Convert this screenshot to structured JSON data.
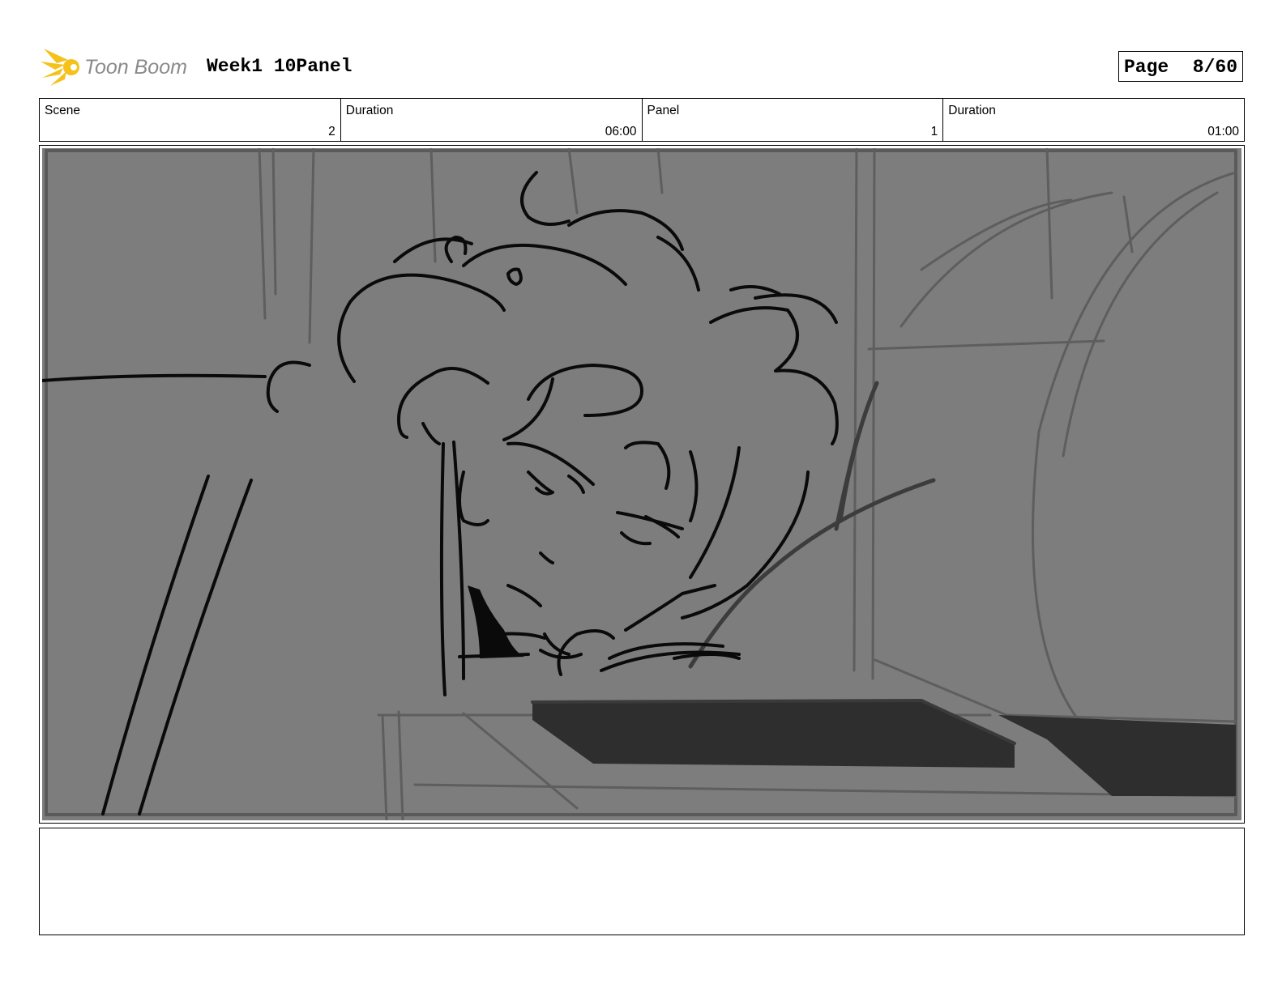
{
  "header": {
    "logo": {
      "text": "Toon Boom",
      "icon": "toon-boom-sun-icon"
    },
    "title": "Week1 10Panel",
    "page": {
      "label": "Page",
      "value": "8/60"
    }
  },
  "info": {
    "scene": {
      "label": "Scene",
      "value": "2"
    },
    "scene_duration": {
      "label": "Duration",
      "value": "06:00"
    },
    "panel": {
      "label": "Panel",
      "value": "1"
    },
    "panel_duration": {
      "label": "Duration",
      "value": "01:00"
    }
  },
  "panel_image": {
    "subject": "storyboard-sketch",
    "background": "#7d7d7d"
  },
  "notes": {
    "text": ""
  },
  "colors": {
    "logo_yellow": "#f5c21b",
    "logo_text": "#8a8a8a",
    "sketch_line": "#0a0a0a"
  }
}
